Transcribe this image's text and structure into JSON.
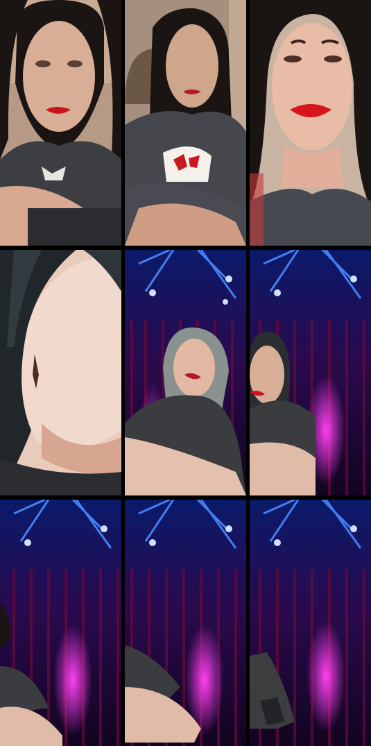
{
  "grid": {
    "columns": 3,
    "rows": 3,
    "tiles": [
      {
        "id": "t1",
        "scene": "room-closeup"
      },
      {
        "id": "t2",
        "scene": "room-medium"
      },
      {
        "id": "t3",
        "scene": "room-closeup-red-lips"
      },
      {
        "id": "t4",
        "scene": "face-extreme-closeup"
      },
      {
        "id": "t5",
        "scene": "stage-lights-person-center"
      },
      {
        "id": "t6",
        "scene": "stage-lights-person-left"
      },
      {
        "id": "t7",
        "scene": "stage-lights-person-edge"
      },
      {
        "id": "t8",
        "scene": "stage-lights-arm-edge"
      },
      {
        "id": "t9",
        "scene": "stage-lights-hand-corner"
      }
    ]
  },
  "colors": {
    "background": "#000000",
    "curtain": "#3a0a4a",
    "curtain_glow": "#d01cc8",
    "spotlight": "#2a6bff",
    "lips": "#c8141e",
    "shirt": "#3d3e42",
    "skin": "#d8a890",
    "hair": "#1a1412"
  }
}
